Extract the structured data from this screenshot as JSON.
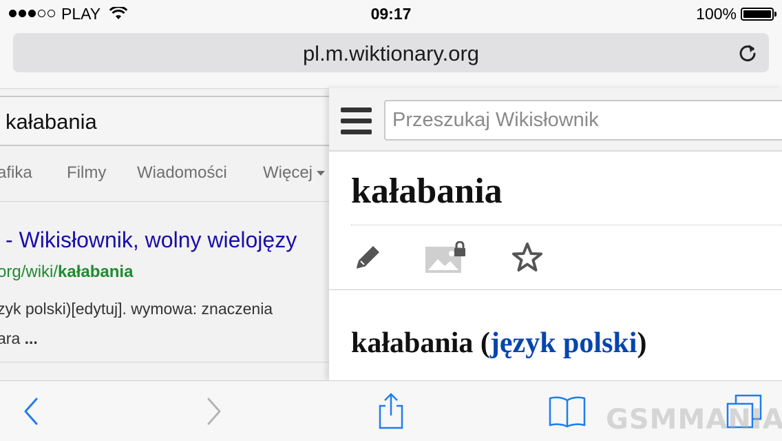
{
  "status_bar": {
    "signal_strength": 3,
    "signal_total": 5,
    "carrier": "PLAY",
    "time": "09:17",
    "battery_percent": "100%"
  },
  "address_bar": {
    "url": "pl.m.wiktionary.org",
    "reload_icon": "reload-icon"
  },
  "google_page": {
    "query": "kałabania",
    "tabs": [
      "rafika",
      "Filmy",
      "Wiadomości",
      "Więcej"
    ],
    "result": {
      "title": "- Wikisłownik, wolny wielojęzy",
      "url_prefix": "org/wiki/",
      "url_bold": "kałabania",
      "snippet_line1": "zyk polski)[edytuj]. wymowa: znaczenia",
      "snippet_line2_text": "ara ",
      "snippet_line2_ellipsis": "..."
    }
  },
  "wiktionary": {
    "menu_icon": "hamburger-icon",
    "search_placeholder": "Przeszukaj Wikisłownik",
    "page_title": "kałabania",
    "actions": [
      "edit-pencil-icon",
      "image-locked-icon",
      "watch-star-icon"
    ],
    "section_word": "kałabania",
    "section_open": " (",
    "section_language_link": "język polski",
    "section_close": ")"
  },
  "toolbar": {
    "buttons": [
      "back-arrow-icon",
      "forward-arrow-icon",
      "share-icon",
      "bookmarks-icon",
      "tabs-icon"
    ],
    "accent_color": "#1f7cf0",
    "disabled_color": "#b4b4b4"
  },
  "watermark": "GSMMANIAK",
  "colors": {
    "link_blue": "#1a0dab",
    "url_green": "#1f8b32",
    "wiki_link": "#0645ad"
  }
}
